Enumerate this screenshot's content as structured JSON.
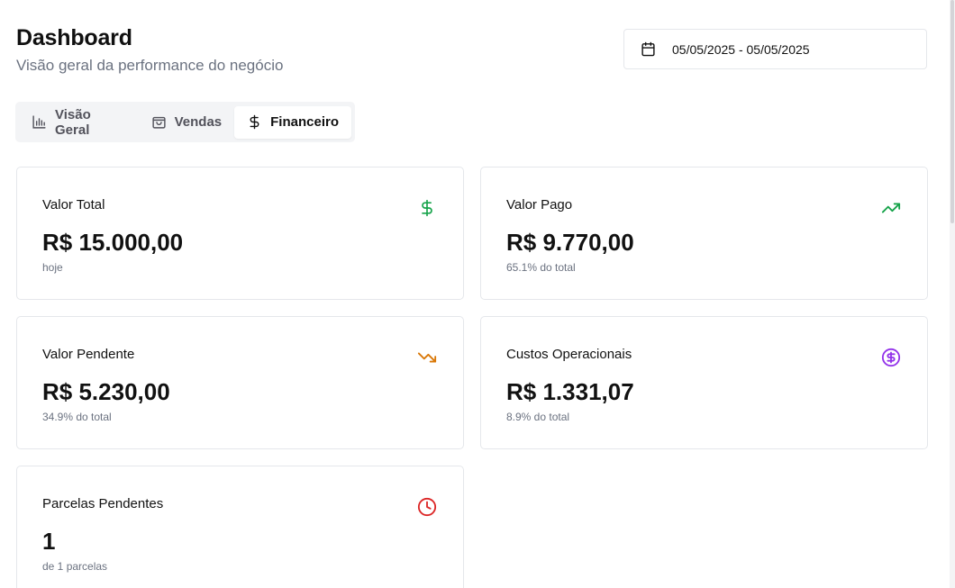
{
  "header": {
    "title": "Dashboard",
    "subtitle": "Visão geral da performance do negócio"
  },
  "date_range": {
    "value": "05/05/2025 - 05/05/2025",
    "icon": "calendar-icon"
  },
  "tabs": [
    {
      "label": "Visão Geral",
      "icon": "bar-chart-icon",
      "active": false
    },
    {
      "label": "Vendas",
      "icon": "shopping-bag-icon",
      "active": false
    },
    {
      "label": "Financeiro",
      "icon": "dollar-icon",
      "active": true
    }
  ],
  "cards": [
    {
      "label": "Valor Total",
      "value": "R$ 15.000,00",
      "sub": "hoje",
      "icon": "dollar-icon",
      "color": "#16a34a"
    },
    {
      "label": "Valor Pago",
      "value": "R$ 9.770,00",
      "sub": "65.1% do total",
      "icon": "trending-up-icon",
      "color": "#16a34a"
    },
    {
      "label": "Valor Pendente",
      "value": "R$ 5.230,00",
      "sub": "34.9% do total",
      "icon": "trending-down-icon",
      "color": "#d97706"
    },
    {
      "label": "Custos Operacionais",
      "value": "R$ 1.331,07",
      "sub": "8.9% do total",
      "icon": "circle-dollar-icon",
      "color": "#9333ea"
    },
    {
      "label": "Parcelas Pendentes",
      "value": "1",
      "sub": "de 1 parcelas",
      "icon": "clock-icon",
      "color": "#dc2626"
    }
  ]
}
